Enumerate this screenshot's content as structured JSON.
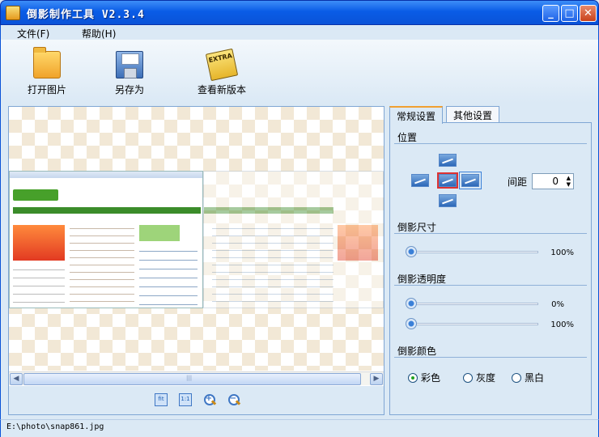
{
  "window": {
    "title": "倒影制作工具 V2.3.4",
    "min": "_",
    "max": "□",
    "close": "✕"
  },
  "menu": {
    "file": "文件(F)",
    "help": "帮助(H)"
  },
  "toolbar": {
    "open": "打开图片",
    "save_as": "另存为",
    "check_version": "查看新版本",
    "extra_badge": "EXTRA"
  },
  "scroll": {
    "left": "◀",
    "right": "▶",
    "grip": "|||"
  },
  "zoom": {
    "fit": "fit",
    "actual": "1:1",
    "zoom_in": "+",
    "zoom_out": "−"
  },
  "tabs": {
    "general": "常规设置",
    "other": "其他设置"
  },
  "position": {
    "label": "位置",
    "spacing_label": "间距",
    "spacing_value": "0",
    "selected": "bottom"
  },
  "size": {
    "label": "倒影尺寸",
    "value": "100%",
    "level": 1.0
  },
  "opacity": {
    "label": "倒影透明度",
    "start_value": "0%",
    "start_level": 0.0,
    "end_value": "100%",
    "end_level": 1.0
  },
  "color": {
    "label": "倒影颜色",
    "options": [
      "彩色",
      "灰度",
      "黑白"
    ],
    "selected": "彩色"
  },
  "status": {
    "path": "E:\\photo\\snap861.jpg"
  }
}
